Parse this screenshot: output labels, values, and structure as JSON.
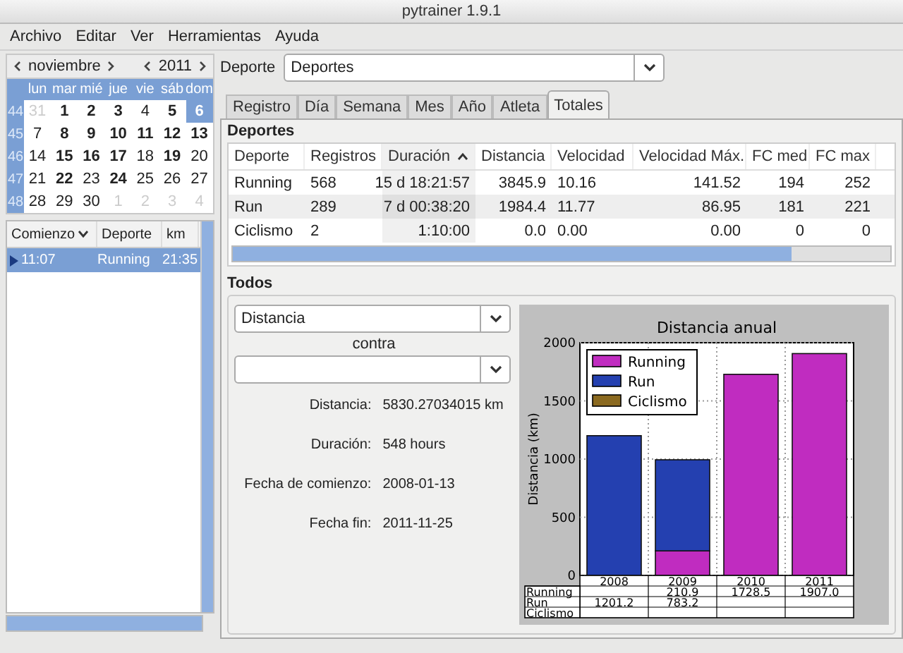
{
  "window": {
    "title": "pytrainer 1.9.1"
  },
  "menu": [
    "Archivo",
    "Editar",
    "Ver",
    "Herramientas",
    "Ayuda"
  ],
  "calendar": {
    "month": "noviembre",
    "year": "2011",
    "weekdays": [
      "lun",
      "mar",
      "mié",
      "jue",
      "vie",
      "sáb",
      "dom"
    ],
    "weeks": [
      {
        "number": "44",
        "days": [
          {
            "text": "31",
            "kind": "other",
            "selected": false
          },
          {
            "text": "1",
            "kind": "bold",
            "selected": false
          },
          {
            "text": "2",
            "kind": "bold",
            "selected": false
          },
          {
            "text": "3",
            "kind": "bold",
            "selected": false
          },
          {
            "text": "4",
            "kind": "plain",
            "selected": false
          },
          {
            "text": "5",
            "kind": "bold",
            "selected": false
          },
          {
            "text": "6",
            "kind": "bold",
            "selected": true
          }
        ]
      },
      {
        "number": "45",
        "days": [
          {
            "text": "7",
            "kind": "plain",
            "selected": false
          },
          {
            "text": "8",
            "kind": "bold",
            "selected": false
          },
          {
            "text": "9",
            "kind": "bold",
            "selected": false
          },
          {
            "text": "10",
            "kind": "bold",
            "selected": false
          },
          {
            "text": "11",
            "kind": "bold",
            "selected": false
          },
          {
            "text": "12",
            "kind": "bold",
            "selected": false
          },
          {
            "text": "13",
            "kind": "bold",
            "selected": false
          }
        ]
      },
      {
        "number": "46",
        "days": [
          {
            "text": "14",
            "kind": "plain",
            "selected": false
          },
          {
            "text": "15",
            "kind": "bold",
            "selected": false
          },
          {
            "text": "16",
            "kind": "bold",
            "selected": false
          },
          {
            "text": "17",
            "kind": "bold",
            "selected": false
          },
          {
            "text": "18",
            "kind": "plain",
            "selected": false
          },
          {
            "text": "19",
            "kind": "bold",
            "selected": false
          },
          {
            "text": "20",
            "kind": "plain",
            "selected": false
          }
        ]
      },
      {
        "number": "47",
        "days": [
          {
            "text": "21",
            "kind": "plain",
            "selected": false
          },
          {
            "text": "22",
            "kind": "bold",
            "selected": false
          },
          {
            "text": "23",
            "kind": "plain",
            "selected": false
          },
          {
            "text": "24",
            "kind": "bold",
            "selected": false
          },
          {
            "text": "25",
            "kind": "plain",
            "selected": false
          },
          {
            "text": "26",
            "kind": "plain",
            "selected": false
          },
          {
            "text": "27",
            "kind": "plain",
            "selected": false
          }
        ]
      },
      {
        "number": "48",
        "days": [
          {
            "text": "28",
            "kind": "plain",
            "selected": false
          },
          {
            "text": "29",
            "kind": "plain",
            "selected": false
          },
          {
            "text": "30",
            "kind": "plain",
            "selected": false
          },
          {
            "text": "1",
            "kind": "other",
            "selected": false
          },
          {
            "text": "2",
            "kind": "other",
            "selected": false
          },
          {
            "text": "3",
            "kind": "other",
            "selected": false
          },
          {
            "text": "4",
            "kind": "other",
            "selected": false
          }
        ]
      }
    ]
  },
  "records": {
    "columns": [
      {
        "label": "Comienzo",
        "sorted": true,
        "ascending": false
      },
      {
        "label": "Deporte",
        "sorted": false
      },
      {
        "label": "km",
        "sorted": false
      }
    ],
    "rows": [
      {
        "cells": [
          "11:07",
          "Running",
          "21:35"
        ],
        "selected": true
      }
    ]
  },
  "sport_filter": {
    "label": "Deporte",
    "value": "Deportes"
  },
  "tabs": [
    {
      "label": "Registro",
      "selected": false
    },
    {
      "label": "Día",
      "selected": false
    },
    {
      "label": "Semana",
      "selected": false
    },
    {
      "label": "Mes",
      "selected": false
    },
    {
      "label": "Año",
      "selected": false
    },
    {
      "label": "Atleta",
      "selected": false
    },
    {
      "label": "Totales",
      "selected": true
    }
  ],
  "sports_table": {
    "title": "Deportes",
    "columns": [
      {
        "label": "Deporte",
        "sorted": false
      },
      {
        "label": "Registros",
        "sorted": false
      },
      {
        "label": "Duración",
        "sorted": true,
        "ascending": true
      },
      {
        "label": "Distancia",
        "sorted": false
      },
      {
        "label": "Velocidad",
        "sorted": false
      },
      {
        "label": "Velocidad Máx.",
        "sorted": false
      },
      {
        "label": "FC med",
        "sorted": false
      },
      {
        "label": "FC max",
        "sorted": false
      }
    ],
    "rows": [
      {
        "cells": [
          "Running",
          "568",
          "15 d 18:21:57",
          "3845.9",
          "10.16",
          "141.52",
          "194",
          "252"
        ]
      },
      {
        "cells": [
          "Run",
          "289",
          "7 d 00:38:20",
          "1984.4",
          "11.77",
          "86.95",
          "181",
          "221"
        ]
      },
      {
        "cells": [
          "Ciclismo",
          "2",
          "1:10:00",
          "0.0",
          "0.00",
          "0.00",
          "0",
          "0"
        ]
      }
    ]
  },
  "totals": {
    "title": "Todos",
    "metric": "Distancia",
    "versus_label": "contra",
    "stats": [
      {
        "label": "Distancia:",
        "value": "5830.27034015 km"
      },
      {
        "label": "Duración:",
        "value": "548 hours"
      },
      {
        "label": "Fecha de comienzo:",
        "value": "2008-01-13"
      },
      {
        "label": "Fecha fin:",
        "value": "2011-11-25"
      }
    ],
    "chart_data": {
      "type": "bar",
      "title": "Distancia anual",
      "ylabel": "Distancia (km)",
      "categories": [
        "2008",
        "2009",
        "2010",
        "2011"
      ],
      "stacked": true,
      "grid": true,
      "ylim": [
        0,
        2000
      ],
      "yticks": [
        0,
        500,
        1000,
        1500,
        2000
      ],
      "series": [
        {
          "name": "Running",
          "color": "#c02cc0",
          "values": [
            0,
            211,
            1729,
            1907
          ]
        },
        {
          "name": "Run",
          "color": "#2440b0",
          "values": [
            1201,
            783,
            0,
            0
          ]
        },
        {
          "name": "Ciclismo",
          "color": "#8b6a20",
          "values": [
            0,
            0,
            0,
            0
          ]
        }
      ]
    },
    "value_table": {
      "rows": [
        {
          "label": "Running",
          "cells": [
            null,
            "210.9",
            "1728.5",
            "1907.0"
          ]
        },
        {
          "label": "Run",
          "cells": [
            "1201.2",
            "783.2",
            null,
            null
          ]
        },
        {
          "label": "Ciclismo",
          "cells": [
            null,
            null,
            null,
            null
          ]
        }
      ]
    }
  }
}
